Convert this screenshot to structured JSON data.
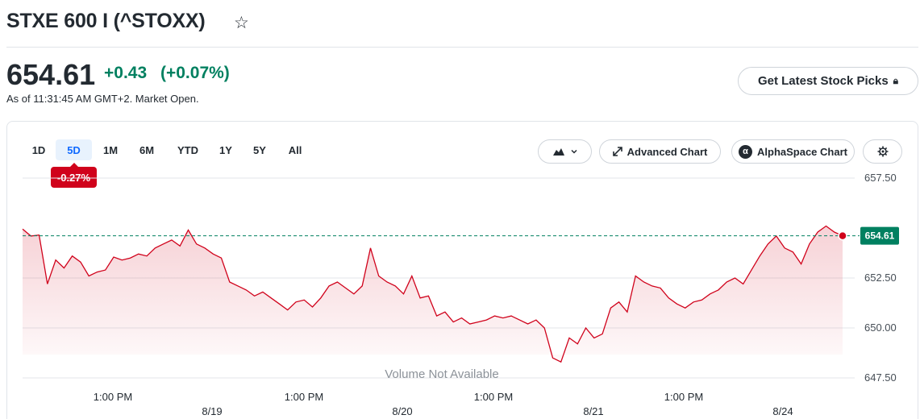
{
  "header": {
    "title": "STXE 600 I (^STOXX)",
    "price": "654.61",
    "change": "+0.43",
    "change_pct": "(+0.07%)",
    "as_of": "As of 11:31:45 AM GMT+2. Market Open.",
    "picks_button": "Get Latest Stock Picks",
    "colors": {
      "positive": "#008060",
      "negative": "#d0021b",
      "accent": "#0f69ff"
    }
  },
  "toolbar": {
    "ranges": [
      "1D",
      "5D",
      "1M",
      "6M",
      "YTD",
      "1Y",
      "5Y",
      "All"
    ],
    "active_range": "5D",
    "range_change": "-0.27%",
    "chart_type_icon": "mountain-chart-icon",
    "advanced_chart": "Advanced Chart",
    "alphaspace_chart": "AlphaSpace Chart",
    "settings_icon": "gear-icon"
  },
  "chart_data": {
    "type": "area",
    "y_ticks": [
      "657.50",
      "652.50",
      "650.00",
      "647.50"
    ],
    "ylim": [
      647.5,
      657.5
    ],
    "current_price_label": "654.61",
    "volume_note": "Volume Not Available",
    "x_time_labels": [
      "1:00 PM",
      "1:00 PM",
      "1:00 PM",
      "1:00 PM"
    ],
    "x_date_labels": [
      "8/19",
      "8/20",
      "8/21",
      "8/24"
    ],
    "grid": true,
    "series": [
      {
        "values": [
          654.95,
          654.6,
          654.65,
          652.2,
          653.4,
          653.0,
          653.6,
          653.3,
          652.6,
          652.8,
          652.9,
          653.55,
          653.4,
          653.5,
          653.7,
          653.6,
          654.0,
          654.2,
          654.4,
          654.1,
          654.9,
          654.2,
          654.0,
          653.7,
          653.5,
          652.3,
          652.1,
          651.9,
          651.6,
          651.8,
          651.5,
          651.2,
          650.9,
          651.3,
          651.4,
          651.05,
          651.5,
          652.1,
          652.3,
          652.0,
          651.7,
          652.1,
          654.0,
          652.6,
          652.3,
          652.1,
          651.7,
          652.6,
          651.5,
          651.6,
          650.6,
          650.8,
          650.3,
          650.5,
          650.2,
          650.3,
          650.4,
          650.6,
          650.5,
          650.6,
          650.4,
          650.2,
          650.4,
          650.0,
          648.5,
          648.3,
          649.5,
          649.2,
          650.0,
          649.5,
          649.7,
          651.0,
          651.3,
          650.8,
          652.6,
          652.3,
          652.1,
          652.0,
          651.5,
          651.2,
          651.0,
          651.3,
          651.4,
          651.7,
          651.9,
          652.3,
          652.5,
          652.2,
          652.9,
          653.6,
          654.2,
          654.6,
          654.0,
          653.8,
          653.2,
          654.2,
          654.8,
          655.1,
          654.8,
          654.61
        ]
      }
    ]
  }
}
